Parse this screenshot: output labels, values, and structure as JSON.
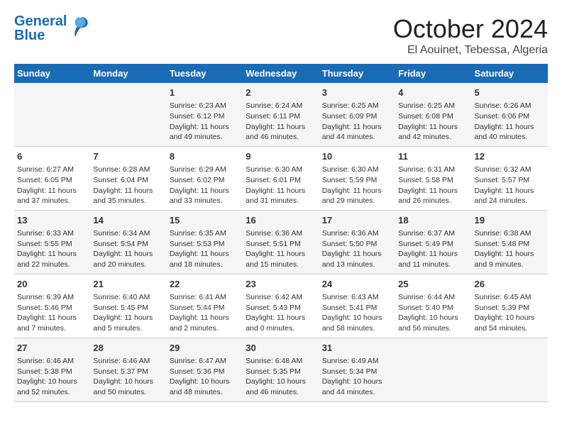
{
  "header": {
    "logo_line1": "General",
    "logo_line2": "Blue",
    "month": "October 2024",
    "location": "El Aouinet, Tebessa, Algeria"
  },
  "weekdays": [
    "Sunday",
    "Monday",
    "Tuesday",
    "Wednesday",
    "Thursday",
    "Friday",
    "Saturday"
  ],
  "weeks": [
    [
      {
        "day": "",
        "sunrise": "",
        "sunset": "",
        "daylight": ""
      },
      {
        "day": "",
        "sunrise": "",
        "sunset": "",
        "daylight": ""
      },
      {
        "day": "1",
        "sunrise": "Sunrise: 6:23 AM",
        "sunset": "Sunset: 6:12 PM",
        "daylight": "Daylight: 11 hours and 49 minutes."
      },
      {
        "day": "2",
        "sunrise": "Sunrise: 6:24 AM",
        "sunset": "Sunset: 6:11 PM",
        "daylight": "Daylight: 11 hours and 46 minutes."
      },
      {
        "day": "3",
        "sunrise": "Sunrise: 6:25 AM",
        "sunset": "Sunset: 6:09 PM",
        "daylight": "Daylight: 11 hours and 44 minutes."
      },
      {
        "day": "4",
        "sunrise": "Sunrise: 6:25 AM",
        "sunset": "Sunset: 6:08 PM",
        "daylight": "Daylight: 11 hours and 42 minutes."
      },
      {
        "day": "5",
        "sunrise": "Sunrise: 6:26 AM",
        "sunset": "Sunset: 6:06 PM",
        "daylight": "Daylight: 11 hours and 40 minutes."
      }
    ],
    [
      {
        "day": "6",
        "sunrise": "Sunrise: 6:27 AM",
        "sunset": "Sunset: 6:05 PM",
        "daylight": "Daylight: 11 hours and 37 minutes."
      },
      {
        "day": "7",
        "sunrise": "Sunrise: 6:28 AM",
        "sunset": "Sunset: 6:04 PM",
        "daylight": "Daylight: 11 hours and 35 minutes."
      },
      {
        "day": "8",
        "sunrise": "Sunrise: 6:29 AM",
        "sunset": "Sunset: 6:02 PM",
        "daylight": "Daylight: 11 hours and 33 minutes."
      },
      {
        "day": "9",
        "sunrise": "Sunrise: 6:30 AM",
        "sunset": "Sunset: 6:01 PM",
        "daylight": "Daylight: 11 hours and 31 minutes."
      },
      {
        "day": "10",
        "sunrise": "Sunrise: 6:30 AM",
        "sunset": "Sunset: 5:59 PM",
        "daylight": "Daylight: 11 hours and 29 minutes."
      },
      {
        "day": "11",
        "sunrise": "Sunrise: 6:31 AM",
        "sunset": "Sunset: 5:58 PM",
        "daylight": "Daylight: 11 hours and 26 minutes."
      },
      {
        "day": "12",
        "sunrise": "Sunrise: 6:32 AM",
        "sunset": "Sunset: 5:57 PM",
        "daylight": "Daylight: 11 hours and 24 minutes."
      }
    ],
    [
      {
        "day": "13",
        "sunrise": "Sunrise: 6:33 AM",
        "sunset": "Sunset: 5:55 PM",
        "daylight": "Daylight: 11 hours and 22 minutes."
      },
      {
        "day": "14",
        "sunrise": "Sunrise: 6:34 AM",
        "sunset": "Sunset: 5:54 PM",
        "daylight": "Daylight: 11 hours and 20 minutes."
      },
      {
        "day": "15",
        "sunrise": "Sunrise: 6:35 AM",
        "sunset": "Sunset: 5:53 PM",
        "daylight": "Daylight: 11 hours and 18 minutes."
      },
      {
        "day": "16",
        "sunrise": "Sunrise: 6:36 AM",
        "sunset": "Sunset: 5:51 PM",
        "daylight": "Daylight: 11 hours and 15 minutes."
      },
      {
        "day": "17",
        "sunrise": "Sunrise: 6:36 AM",
        "sunset": "Sunset: 5:50 PM",
        "daylight": "Daylight: 11 hours and 13 minutes."
      },
      {
        "day": "18",
        "sunrise": "Sunrise: 6:37 AM",
        "sunset": "Sunset: 5:49 PM",
        "daylight": "Daylight: 11 hours and 11 minutes."
      },
      {
        "day": "19",
        "sunrise": "Sunrise: 6:38 AM",
        "sunset": "Sunset: 5:48 PM",
        "daylight": "Daylight: 11 hours and 9 minutes."
      }
    ],
    [
      {
        "day": "20",
        "sunrise": "Sunrise: 6:39 AM",
        "sunset": "Sunset: 5:46 PM",
        "daylight": "Daylight: 11 hours and 7 minutes."
      },
      {
        "day": "21",
        "sunrise": "Sunrise: 6:40 AM",
        "sunset": "Sunset: 5:45 PM",
        "daylight": "Daylight: 11 hours and 5 minutes."
      },
      {
        "day": "22",
        "sunrise": "Sunrise: 6:41 AM",
        "sunset": "Sunset: 5:44 PM",
        "daylight": "Daylight: 11 hours and 2 minutes."
      },
      {
        "day": "23",
        "sunrise": "Sunrise: 6:42 AM",
        "sunset": "Sunset: 5:43 PM",
        "daylight": "Daylight: 11 hours and 0 minutes."
      },
      {
        "day": "24",
        "sunrise": "Sunrise: 6:43 AM",
        "sunset": "Sunset: 5:41 PM",
        "daylight": "Daylight: 10 hours and 58 minutes."
      },
      {
        "day": "25",
        "sunrise": "Sunrise: 6:44 AM",
        "sunset": "Sunset: 5:40 PM",
        "daylight": "Daylight: 10 hours and 56 minutes."
      },
      {
        "day": "26",
        "sunrise": "Sunrise: 6:45 AM",
        "sunset": "Sunset: 5:39 PM",
        "daylight": "Daylight: 10 hours and 54 minutes."
      }
    ],
    [
      {
        "day": "27",
        "sunrise": "Sunrise: 6:46 AM",
        "sunset": "Sunset: 5:38 PM",
        "daylight": "Daylight: 10 hours and 52 minutes."
      },
      {
        "day": "28",
        "sunrise": "Sunrise: 6:46 AM",
        "sunset": "Sunset: 5:37 PM",
        "daylight": "Daylight: 10 hours and 50 minutes."
      },
      {
        "day": "29",
        "sunrise": "Sunrise: 6:47 AM",
        "sunset": "Sunset: 5:36 PM",
        "daylight": "Daylight: 10 hours and 48 minutes."
      },
      {
        "day": "30",
        "sunrise": "Sunrise: 6:48 AM",
        "sunset": "Sunset: 5:35 PM",
        "daylight": "Daylight: 10 hours and 46 minutes."
      },
      {
        "day": "31",
        "sunrise": "Sunrise: 6:49 AM",
        "sunset": "Sunset: 5:34 PM",
        "daylight": "Daylight: 10 hours and 44 minutes."
      },
      {
        "day": "",
        "sunrise": "",
        "sunset": "",
        "daylight": ""
      },
      {
        "day": "",
        "sunrise": "",
        "sunset": "",
        "daylight": ""
      }
    ]
  ]
}
